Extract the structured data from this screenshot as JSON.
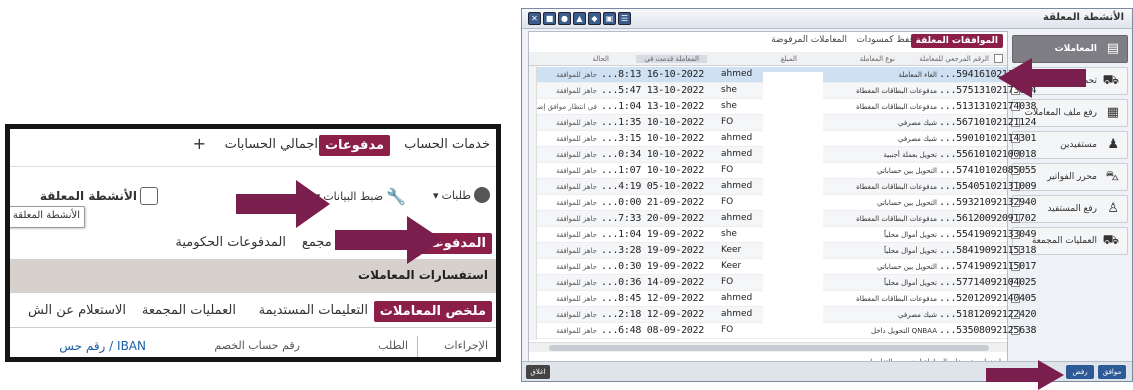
{
  "left": {
    "tabs": [
      "خدمات الحساب",
      "مدفوعات",
      "اجمالي الحسابات",
      "+"
    ],
    "toolbar": {
      "pending": "الأنشطة المعلقة",
      "settings": "ضبط البيانات",
      "requests": "طلبات"
    },
    "tooltip": "الأنشطة المعلقة",
    "subtabs": [
      "المدفوعات",
      "تحميل ملف مجمع",
      "المدفوعات الحكومية"
    ],
    "section_title": "استفسارات المعاملات",
    "summary_tabs": [
      "ملخص المعاملات",
      "التعليمات المستديمة",
      "العمليات المجمعة",
      "الاستعلام عن الش"
    ],
    "header_cols": [
      "الإجراءات",
      "الطلب",
      "رقم حساب الخصم",
      "IBAN / رقم حس"
    ]
  },
  "right": {
    "title": "الأنشطة المعلقة",
    "side_items": [
      {
        "label": "المعاملات",
        "icon": "📋"
      },
      {
        "label": "تحميل ملف",
        "icon": "🚜"
      },
      {
        "label": "رفع ملف المعاملات",
        "icon": "📄"
      },
      {
        "label": "مستفيدين",
        "icon": "👥"
      },
      {
        "label": "محرر الفواتير",
        "icon": "🚗"
      },
      {
        "label": "رفع المستفيد",
        "icon": "👤"
      },
      {
        "label": "العمليات المجمعة",
        "icon": "🚛"
      }
    ],
    "tabs": [
      "الموافقات المعلقة",
      "حفظ كمسودات",
      "المعاملات المرفوضة"
    ],
    "grid_headers": [
      "الرقم المرجعي للمعاملة",
      "نوع المعاملة",
      "المبلغ",
      "المعاملة قدمت في",
      "الحالة"
    ],
    "rows": [
      {
        "ref": "...59416102115813",
        "type": "الغاء المعاملة",
        "user": "ahmed",
        "date": "...8:13 16-10-2022",
        "status": "جاهز للموافقة"
      },
      {
        "ref": "...57513102173624",
        "type": "مدفوعات البطاقات المغطاة",
        "user": "she",
        "date": "...5:47 13-10-2022",
        "status": "جاهز للموافقة"
      },
      {
        "ref": "...51313102174038",
        "type": "مدفوعات البطاقات المغطاة",
        "user": "she",
        "date": "...1:04 13-10-2022",
        "status": "في انتظار موافق إضـ"
      },
      {
        "ref": "...56710102121124",
        "type": "شيك مصرفي",
        "user": "FO",
        "date": "...1:35 10-10-2022",
        "status": "جاهز للموافقة"
      },
      {
        "ref": "...59010102114301",
        "type": "شيك مصرفي",
        "user": "ahmed",
        "date": "...3:15 10-10-2022",
        "status": "جاهز للموافقة"
      },
      {
        "ref": "...55610102100018",
        "type": "تحويل بعملة أجنبية",
        "user": "ahmed",
        "date": "...0:34 10-10-2022",
        "status": "جاهز للموافقة"
      },
      {
        "ref": "...57410102085055",
        "type": "التحويل بين حساباتي",
        "user": "FO",
        "date": "...1:07 10-10-2022",
        "status": "جاهز للموافقة"
      },
      {
        "ref": "...55405102131009",
        "type": "مدفوعات البطاقات المغطاة",
        "user": "ahmed",
        "date": "...4:19 05-10-2022",
        "status": "جاهز للموافقة"
      },
      {
        "ref": "...59321092132940",
        "type": "التحويل بين حساباتي",
        "user": "FO",
        "date": "...0:00 21-09-2022",
        "status": "جاهز للموافقة"
      },
      {
        "ref": "...56120092091702",
        "type": "مدفوعات البطاقات المغطاة",
        "user": "ahmed",
        "date": "...7:33 20-09-2022",
        "status": "جاهز للموافقة"
      },
      {
        "ref": "...55419092133049",
        "type": "تحويل أموال محلياً",
        "user": "she",
        "date": "...1:04 19-09-2022",
        "status": "جاهز للموافقة"
      },
      {
        "ref": "...58419092115318",
        "type": "تحويل أموال محلياً",
        "user": "Keer",
        "date": "...3:28 19-09-2022",
        "status": "جاهز للموافقة"
      },
      {
        "ref": "...57419092115017",
        "type": "التحويل بين حساباتي",
        "user": "Keer",
        "date": "...0:30 19-09-2022",
        "status": "جاهز للموافقة"
      },
      {
        "ref": "...57714092104025",
        "type": "تحويل أموال محلياً",
        "user": "FO",
        "date": "...0:36 14-09-2022",
        "status": "جاهز للموافقة"
      },
      {
        "ref": "...52012092140405",
        "type": "مدفوعات البطاقات المغطاة",
        "user": "ahmed",
        "date": "...8:45 12-09-2022",
        "status": "جاهز للموافقة"
      },
      {
        "ref": "...51812092122420",
        "type": "شيك مصرفي",
        "user": "ahmed",
        "date": "...2:18 12-09-2022",
        "status": "جاهز للموافقة"
      },
      {
        "ref": "...53508092125638",
        "type": "التحويل داخل QNBAA",
        "user": "FO",
        "date": "...6:48 08-09-2022",
        "status": "جاهز للموافقة"
      }
    ],
    "hint": "اضغط مرتين على المعاملة لمزيد من التفاصيل",
    "approve": "موافق",
    "reject": "رفض",
    "close": "اغلاق"
  },
  "colors": {
    "accent": "#8c1f47",
    "arrow": "#7a1e4e",
    "blue_btn": "#2c5a96"
  }
}
